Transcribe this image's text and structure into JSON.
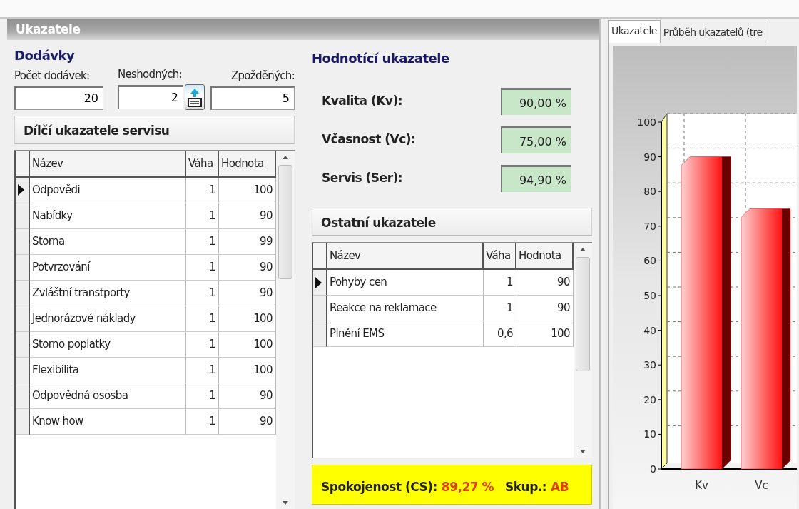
{
  "panel_title": "Ukazatele",
  "deliveries": {
    "heading": "Dodávky",
    "fields": [
      {
        "label": "Počet dodávek:",
        "value": "20",
        "kind": "plain"
      },
      {
        "label": "Neshodných:",
        "value": "2",
        "kind": "with_button"
      },
      {
        "label": "Zpožděných:",
        "value": "5",
        "kind": "plain"
      }
    ]
  },
  "service_table": {
    "title": "Dílčí ukazatele servisu",
    "columns": [
      "Název",
      "Váha",
      "Hodnota"
    ],
    "rows": [
      {
        "cells": [
          "Odpovědi",
          "1",
          "100"
        ],
        "selected": true
      },
      {
        "cells": [
          "Nabídky",
          "1",
          "90"
        ],
        "selected": false
      },
      {
        "cells": [
          "Storna",
          "1",
          "99"
        ],
        "selected": false
      },
      {
        "cells": [
          "Potvrzování",
          "1",
          "90"
        ],
        "selected": false
      },
      {
        "cells": [
          "Zvláštní transtporty",
          "1",
          "90"
        ],
        "selected": false
      },
      {
        "cells": [
          "Jednorázové náklady",
          "1",
          "100"
        ],
        "selected": false
      },
      {
        "cells": [
          "Storno poplatky",
          "1",
          "100"
        ],
        "selected": false
      },
      {
        "cells": [
          "Flexibilita",
          "1",
          "100"
        ],
        "selected": false
      },
      {
        "cells": [
          "Odpovědná ososba",
          "1",
          "90"
        ],
        "selected": false
      },
      {
        "cells": [
          "Know how",
          "1",
          "90"
        ],
        "selected": false
      }
    ]
  },
  "evaluation": {
    "heading": "Hodnotící ukazatele",
    "metrics": [
      {
        "label": "Kvalita (Kv):",
        "value": "90,00 %"
      },
      {
        "label": "Včasnost (Vc):",
        "value": "75,00 %"
      },
      {
        "label": "Servis (Ser):",
        "value": "94,90 %"
      }
    ]
  },
  "other_table": {
    "title": "Ostatní ukazatele",
    "columns": [
      "Název",
      "Váha",
      "Hodnota"
    ],
    "rows": [
      {
        "cells": [
          "Pohyby cen",
          "1",
          "90"
        ],
        "selected": true
      },
      {
        "cells": [
          "Reakce na reklamace",
          "1",
          "90"
        ],
        "selected": false
      },
      {
        "cells": [
          "Plnění EMS",
          "0,6",
          "100"
        ],
        "selected": false
      }
    ]
  },
  "satisfaction": {
    "label": "Spokojenost (CS):",
    "value": "89,27 %",
    "group_label": "Skup.:",
    "group": "AB"
  },
  "tabs": [
    {
      "label": "Ukazatele",
      "selected": true
    },
    {
      "label": "Průběh ukazatelů (tre",
      "selected": false
    }
  ],
  "chart": {
    "chart_data": {
      "type": "bar",
      "categories": [
        "Kv",
        "Vc"
      ],
      "series": [
        {
          "color": "#e00000",
          "values": [
            90,
            75
          ]
        }
      ],
      "ylim": [
        0,
        100
      ],
      "yticks": [
        0,
        10,
        20,
        30,
        40,
        50,
        60,
        70,
        80,
        90,
        100
      ]
    }
  }
}
